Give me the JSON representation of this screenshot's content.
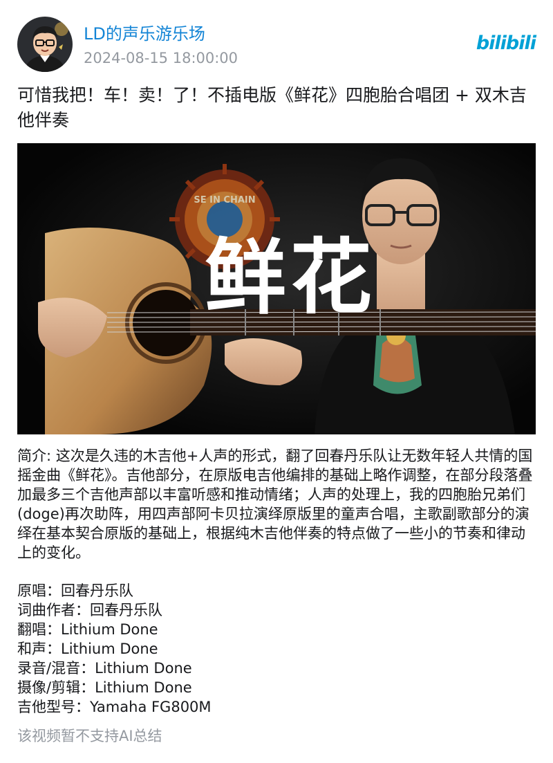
{
  "author": {
    "name": "LD的声乐游乐场",
    "post_time": "2024-08-15 18:00:00"
  },
  "brand": {
    "logo_text": "bilibili",
    "accent_color": "#00a1d6",
    "name_color": "#1485d6"
  },
  "video": {
    "title": "可惜我把！车！卖！了！不插电版《鲜花》四胞胎合唱团 + 双木吉他伴奏",
    "cover_title_text": "鲜花",
    "cover_shirt_text": "SE IN CHAIN"
  },
  "description": {
    "label": "简介: ",
    "text": "这次是久违的木吉他+人声的形式，翻了回春丹乐队让无数年轻人共情的国摇金曲《鲜花》。吉他部分，在原版电吉他编排的基础上略作调整，在部分段落叠加最多三个吉他声部以丰富听感和推动情绪；人声的处理上，我的四胞胎兄弟们(doge)再次助阵，用四声部阿卡贝拉演绎原版里的童声合唱，主歌副歌部分的演绎在基本契合原版的基础上，根据纯木吉他伴奏的特点做了一些小的节奏和律动上的变化。"
  },
  "credits": [
    "原唱：回春丹乐队",
    "词曲作者：回春丹乐队",
    "翻唱：Lithium Done",
    "和声：Lithium Done",
    "录音/混音：Lithium Done",
    "摄像/剪辑：Lithium Done",
    "吉他型号：Yamaha FG800M"
  ],
  "ai_note": "该视频暂不支持AI总结"
}
